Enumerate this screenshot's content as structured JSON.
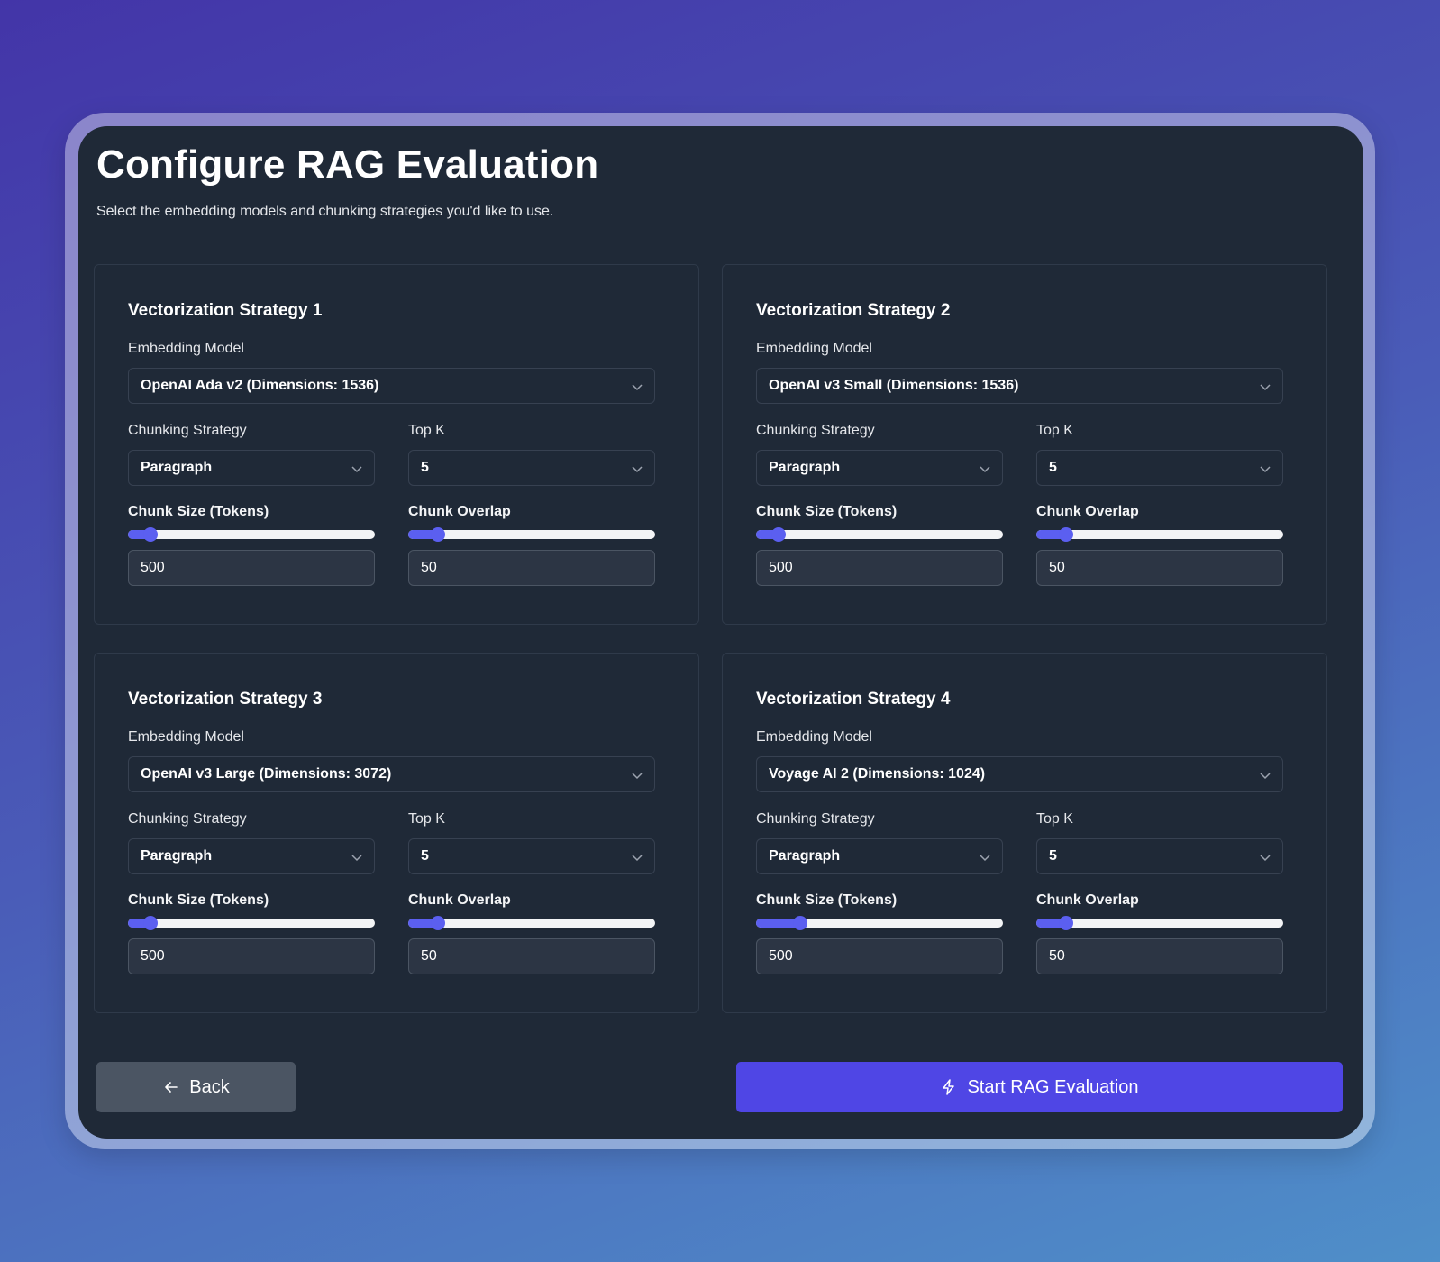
{
  "page": {
    "title": "Configure RAG Evaluation",
    "subtitle": "Select the embedding models and chunking strategies you'd like to use."
  },
  "labels": {
    "embedding_model": "Embedding Model",
    "chunking_strategy": "Chunking Strategy",
    "top_k": "Top K",
    "chunk_size": "Chunk Size (Tokens)",
    "chunk_overlap": "Chunk Overlap"
  },
  "strategies": [
    {
      "title": "Vectorization Strategy 1",
      "embedding_model": "OpenAI Ada v2 (Dimensions: 1536)",
      "chunking_strategy": "Paragraph",
      "top_k": "5",
      "chunk_size": "500",
      "chunk_overlap": "50",
      "chunk_size_level": 0.09,
      "chunk_overlap_level": 0.12
    },
    {
      "title": "Vectorization Strategy 2",
      "embedding_model": "OpenAI v3 Small (Dimensions: 1536)",
      "chunking_strategy": "Paragraph",
      "top_k": "5",
      "chunk_size": "500",
      "chunk_overlap": "50",
      "chunk_size_level": 0.09,
      "chunk_overlap_level": 0.12
    },
    {
      "title": "Vectorization Strategy 3",
      "embedding_model": "OpenAI v3 Large (Dimensions: 3072)",
      "chunking_strategy": "Paragraph",
      "top_k": "5",
      "chunk_size": "500",
      "chunk_overlap": "50",
      "chunk_size_level": 0.09,
      "chunk_overlap_level": 0.12
    },
    {
      "title": "Vectorization Strategy 4",
      "embedding_model": "Voyage AI 2 (Dimensions: 1024)",
      "chunking_strategy": "Paragraph",
      "top_k": "5",
      "chunk_size": "500",
      "chunk_overlap": "50",
      "chunk_size_level": 0.18,
      "chunk_overlap_level": 0.12
    }
  ],
  "buttons": {
    "back": "Back",
    "start": "Start RAG Evaluation"
  },
  "icons": {
    "back": "arrow-left-icon",
    "start": "lightning-bolt-icon",
    "select": "chevron-down-icon"
  },
  "colors": {
    "accent": "#4f46e5",
    "slider": "#5b5ff0",
    "panel": "#1f2937"
  }
}
